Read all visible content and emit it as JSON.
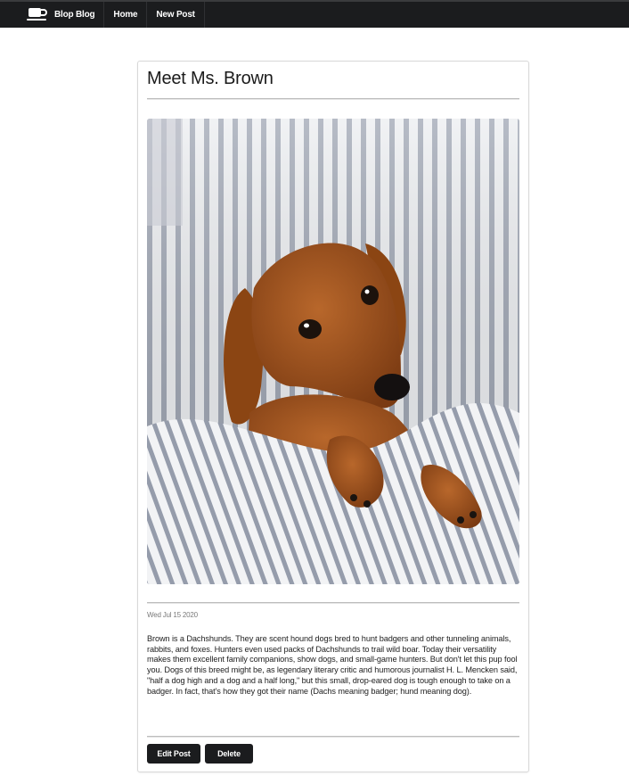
{
  "nav": {
    "brand": "Blop Blog",
    "items": [
      "Home",
      "New Post"
    ],
    "brand_icon": "coffee-cup-icon"
  },
  "post": {
    "title": "Meet Ms. Brown",
    "image_subject": "dachshund-photo",
    "date": "Wed Jul 15 2020",
    "body": "Brown is a Dachshunds. They are scent hound dogs bred to hunt badgers and other tunneling animals, rabbits, and foxes. Hunters even used packs of Dachshunds to trail wild boar. Today their versatility makes them excellent family companions, show dogs, and small-game hunters. But don't let this pup fool you. Dogs of this breed might be, as legendary literary critic and humorous journalist H. L. Mencken said, \"half a dog high and a dog and a half long,\" but this small, drop-eared dog is tough enough to take on a badger. In fact, that's how they got their name (Dachs meaning badger; hund meaning dog).",
    "edit_label": "Edit Post",
    "delete_label": "Delete"
  },
  "colors": {
    "navbar": "#1b1c1e",
    "button": "#1b1c1e",
    "dog": "#a5561f"
  }
}
